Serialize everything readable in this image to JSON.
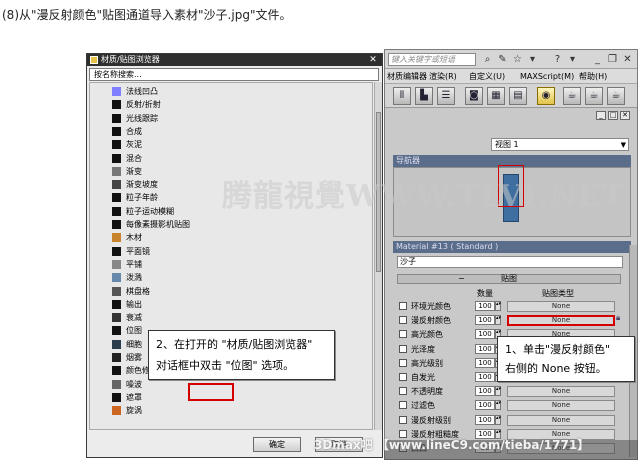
{
  "instruction": "(8)从\"漫反射颜色\"贴图通道导入素材\"沙子.jpg\"文件。",
  "max": {
    "search_placeholder": "键入关键字或短语",
    "menu": [
      "材质编辑器",
      "渲染(R)",
      "自定义(U)",
      "MAXScript(M)",
      "帮助(H)"
    ],
    "view_dropdown": "视图 1",
    "navigator_label": "导航器",
    "material_header": "Material #13  ( Standard )",
    "material_name": "沙子",
    "maps_rollout": "贴图",
    "col_amount": "数量",
    "col_maptype": "贴图类型",
    "maps": [
      {
        "label": "环境光颜色",
        "amount": "100",
        "button": "None"
      },
      {
        "label": "漫反射颜色",
        "amount": "100",
        "button": "None"
      },
      {
        "label": "高光颜色",
        "amount": "100",
        "button": "None"
      },
      {
        "label": "光泽度",
        "amount": "100",
        "button": "None"
      },
      {
        "label": "高光级别",
        "amount": "100",
        "button": "None"
      },
      {
        "label": "自发光",
        "amount": "100",
        "button": "None"
      },
      {
        "label": "不透明度",
        "amount": "100",
        "button": "None"
      },
      {
        "label": "过滤色",
        "amount": "100",
        "button": "None"
      },
      {
        "label": "漫反射级别",
        "amount": "100",
        "button": "None"
      },
      {
        "label": "漫反射粗糙度",
        "amount": "100",
        "button": "None"
      },
      {
        "label": "凹凸",
        "amount": "30",
        "button": "None"
      }
    ]
  },
  "dialog": {
    "title": "材质/贴图浏览器",
    "search": "按名称搜索...",
    "items": [
      {
        "label": "法线凹凸",
        "thumb": "#8080ff"
      },
      {
        "label": "反射/折射",
        "thumb": "#111111"
      },
      {
        "label": "光线跟踪",
        "thumb": "#111111"
      },
      {
        "label": "合成",
        "thumb": "#111111"
      },
      {
        "label": "灰泥",
        "thumb": "#111111"
      },
      {
        "label": "混合",
        "thumb": "#111111"
      },
      {
        "label": "渐变",
        "thumb": "#777777"
      },
      {
        "label": "渐变坡度",
        "thumb": "#444444"
      },
      {
        "label": "粒子年龄",
        "thumb": "#111111"
      },
      {
        "label": "粒子运动模糊",
        "thumb": "#111111"
      },
      {
        "label": "每像素摄影机贴图",
        "thumb": "#111111"
      },
      {
        "label": "木材",
        "thumb": "#c8842c"
      },
      {
        "label": "平面镜",
        "thumb": "#111111"
      },
      {
        "label": "平铺",
        "thumb": "#888888"
      },
      {
        "label": "泼溅",
        "thumb": "#6688aa"
      },
      {
        "label": "棋盘格",
        "thumb": "#555555"
      },
      {
        "label": "输出",
        "thumb": "#111111"
      },
      {
        "label": "衰减",
        "thumb": "#333333"
      },
      {
        "label": "位图",
        "thumb": "#111111"
      },
      {
        "label": "细胞",
        "thumb": "#2a3b4c"
      },
      {
        "label": "烟雾",
        "thumb": "#222222"
      },
      {
        "label": "颜色修正",
        "thumb": "#111111"
      },
      {
        "label": "噪波",
        "thumb": "#666666"
      },
      {
        "label": "遮罩",
        "thumb": "#111111"
      },
      {
        "label": "旋涡",
        "thumb": "#cc6622"
      }
    ],
    "ok": "确定",
    "cancel": "取消"
  },
  "callout1": {
    "line1": "2、在打开的 \"材质/贴图浏览器\"",
    "line2": "对话框中双击 \"位图\" 选项。"
  },
  "callout2": {
    "line1": "1、单击\"漫反射颜色\"",
    "line2": "右侧的 None 按钮。"
  },
  "watermark_top": "腾龍視覺WWW.TLVI.NET",
  "watermark_bottom": "3Dmax吧 【www.lineC9.com/tieba/1771】"
}
